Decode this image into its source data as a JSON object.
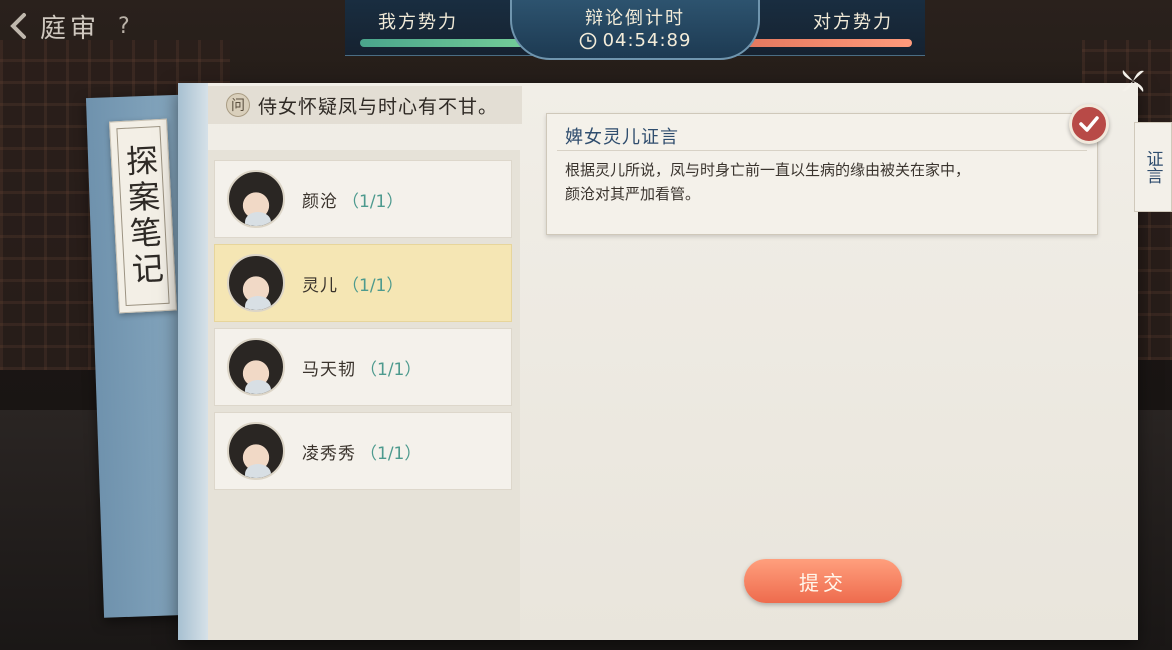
{
  "header": {
    "title": "庭审",
    "help_label": "?"
  },
  "banner": {
    "our_side": "我方势力",
    "their_side": "对方势力",
    "countdown_label": "辩论倒计时",
    "countdown_time": "04:54:89"
  },
  "notebook": {
    "cover_title": "探案笔记"
  },
  "question": {
    "badge": "问",
    "text": "侍女怀疑凤与时心有不甘。"
  },
  "characters": [
    {
      "name": "颜沧",
      "count": "（1/1）"
    },
    {
      "name": "灵儿",
      "count": "（1/1）"
    },
    {
      "name": "马天韧",
      "count": "（1/1）"
    },
    {
      "name": "凌秀秀",
      "count": "（1/1）"
    }
  ],
  "selected_character": "灵儿",
  "evidence": {
    "title": "婢女灵儿证言",
    "body_line1": "根据灵儿所说，凤与时身亡前一直以生病的缘由被关在家中，",
    "body_line2": "颜沧对其严加看管。"
  },
  "side_tab": {
    "label": "证言"
  },
  "submit_label": "提交",
  "colors": {
    "our_bar": "#5fbf93",
    "their_bar": "#f28466",
    "submit": "#f07a58",
    "check": "#b84a47"
  }
}
